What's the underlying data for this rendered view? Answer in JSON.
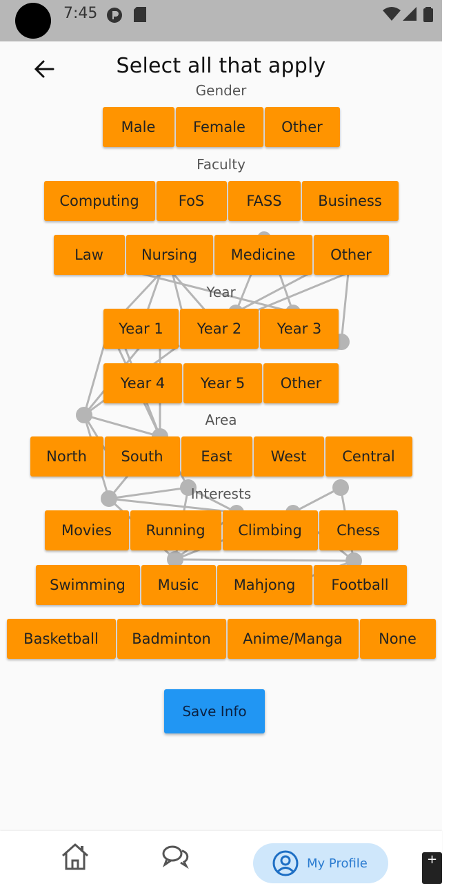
{
  "status_bar": {
    "time": "7:45"
  },
  "header": {
    "title": "Select all that apply"
  },
  "sections": {
    "gender": {
      "label": "Gender",
      "options": [
        "Male",
        "Female",
        "Other"
      ]
    },
    "faculty": {
      "label": "Faculty",
      "row1": [
        "Computing",
        "FoS",
        "FASS",
        "Business"
      ],
      "row2": [
        "Law",
        "Nursing",
        "Medicine",
        "Other"
      ]
    },
    "year": {
      "label": "Year",
      "row1": [
        "Year 1",
        "Year 2",
        "Year 3"
      ],
      "row2": [
        "Year 4",
        "Year 5",
        "Other"
      ]
    },
    "area": {
      "label": "Area",
      "options": [
        "North",
        "South",
        "East",
        "West",
        "Central"
      ]
    },
    "interests": {
      "label": "Interests",
      "row1": [
        "Movies",
        "Running",
        "Climbing",
        "Chess"
      ],
      "row2": [
        "Swimming",
        "Music",
        "Mahjong",
        "Football"
      ],
      "row3": [
        "Basketball",
        "Badminton",
        "Anime/Manga",
        "None"
      ]
    }
  },
  "save_button": {
    "label": "Save Info"
  },
  "bottom_nav": {
    "items": [
      {
        "icon": "home-icon"
      },
      {
        "icon": "chat-icon"
      },
      {
        "icon": "profile-icon",
        "label": "My Profile"
      }
    ]
  },
  "colors": {
    "chip": "#ff9400",
    "save": "#2196f3",
    "nav_active": "#cfe7fb"
  }
}
